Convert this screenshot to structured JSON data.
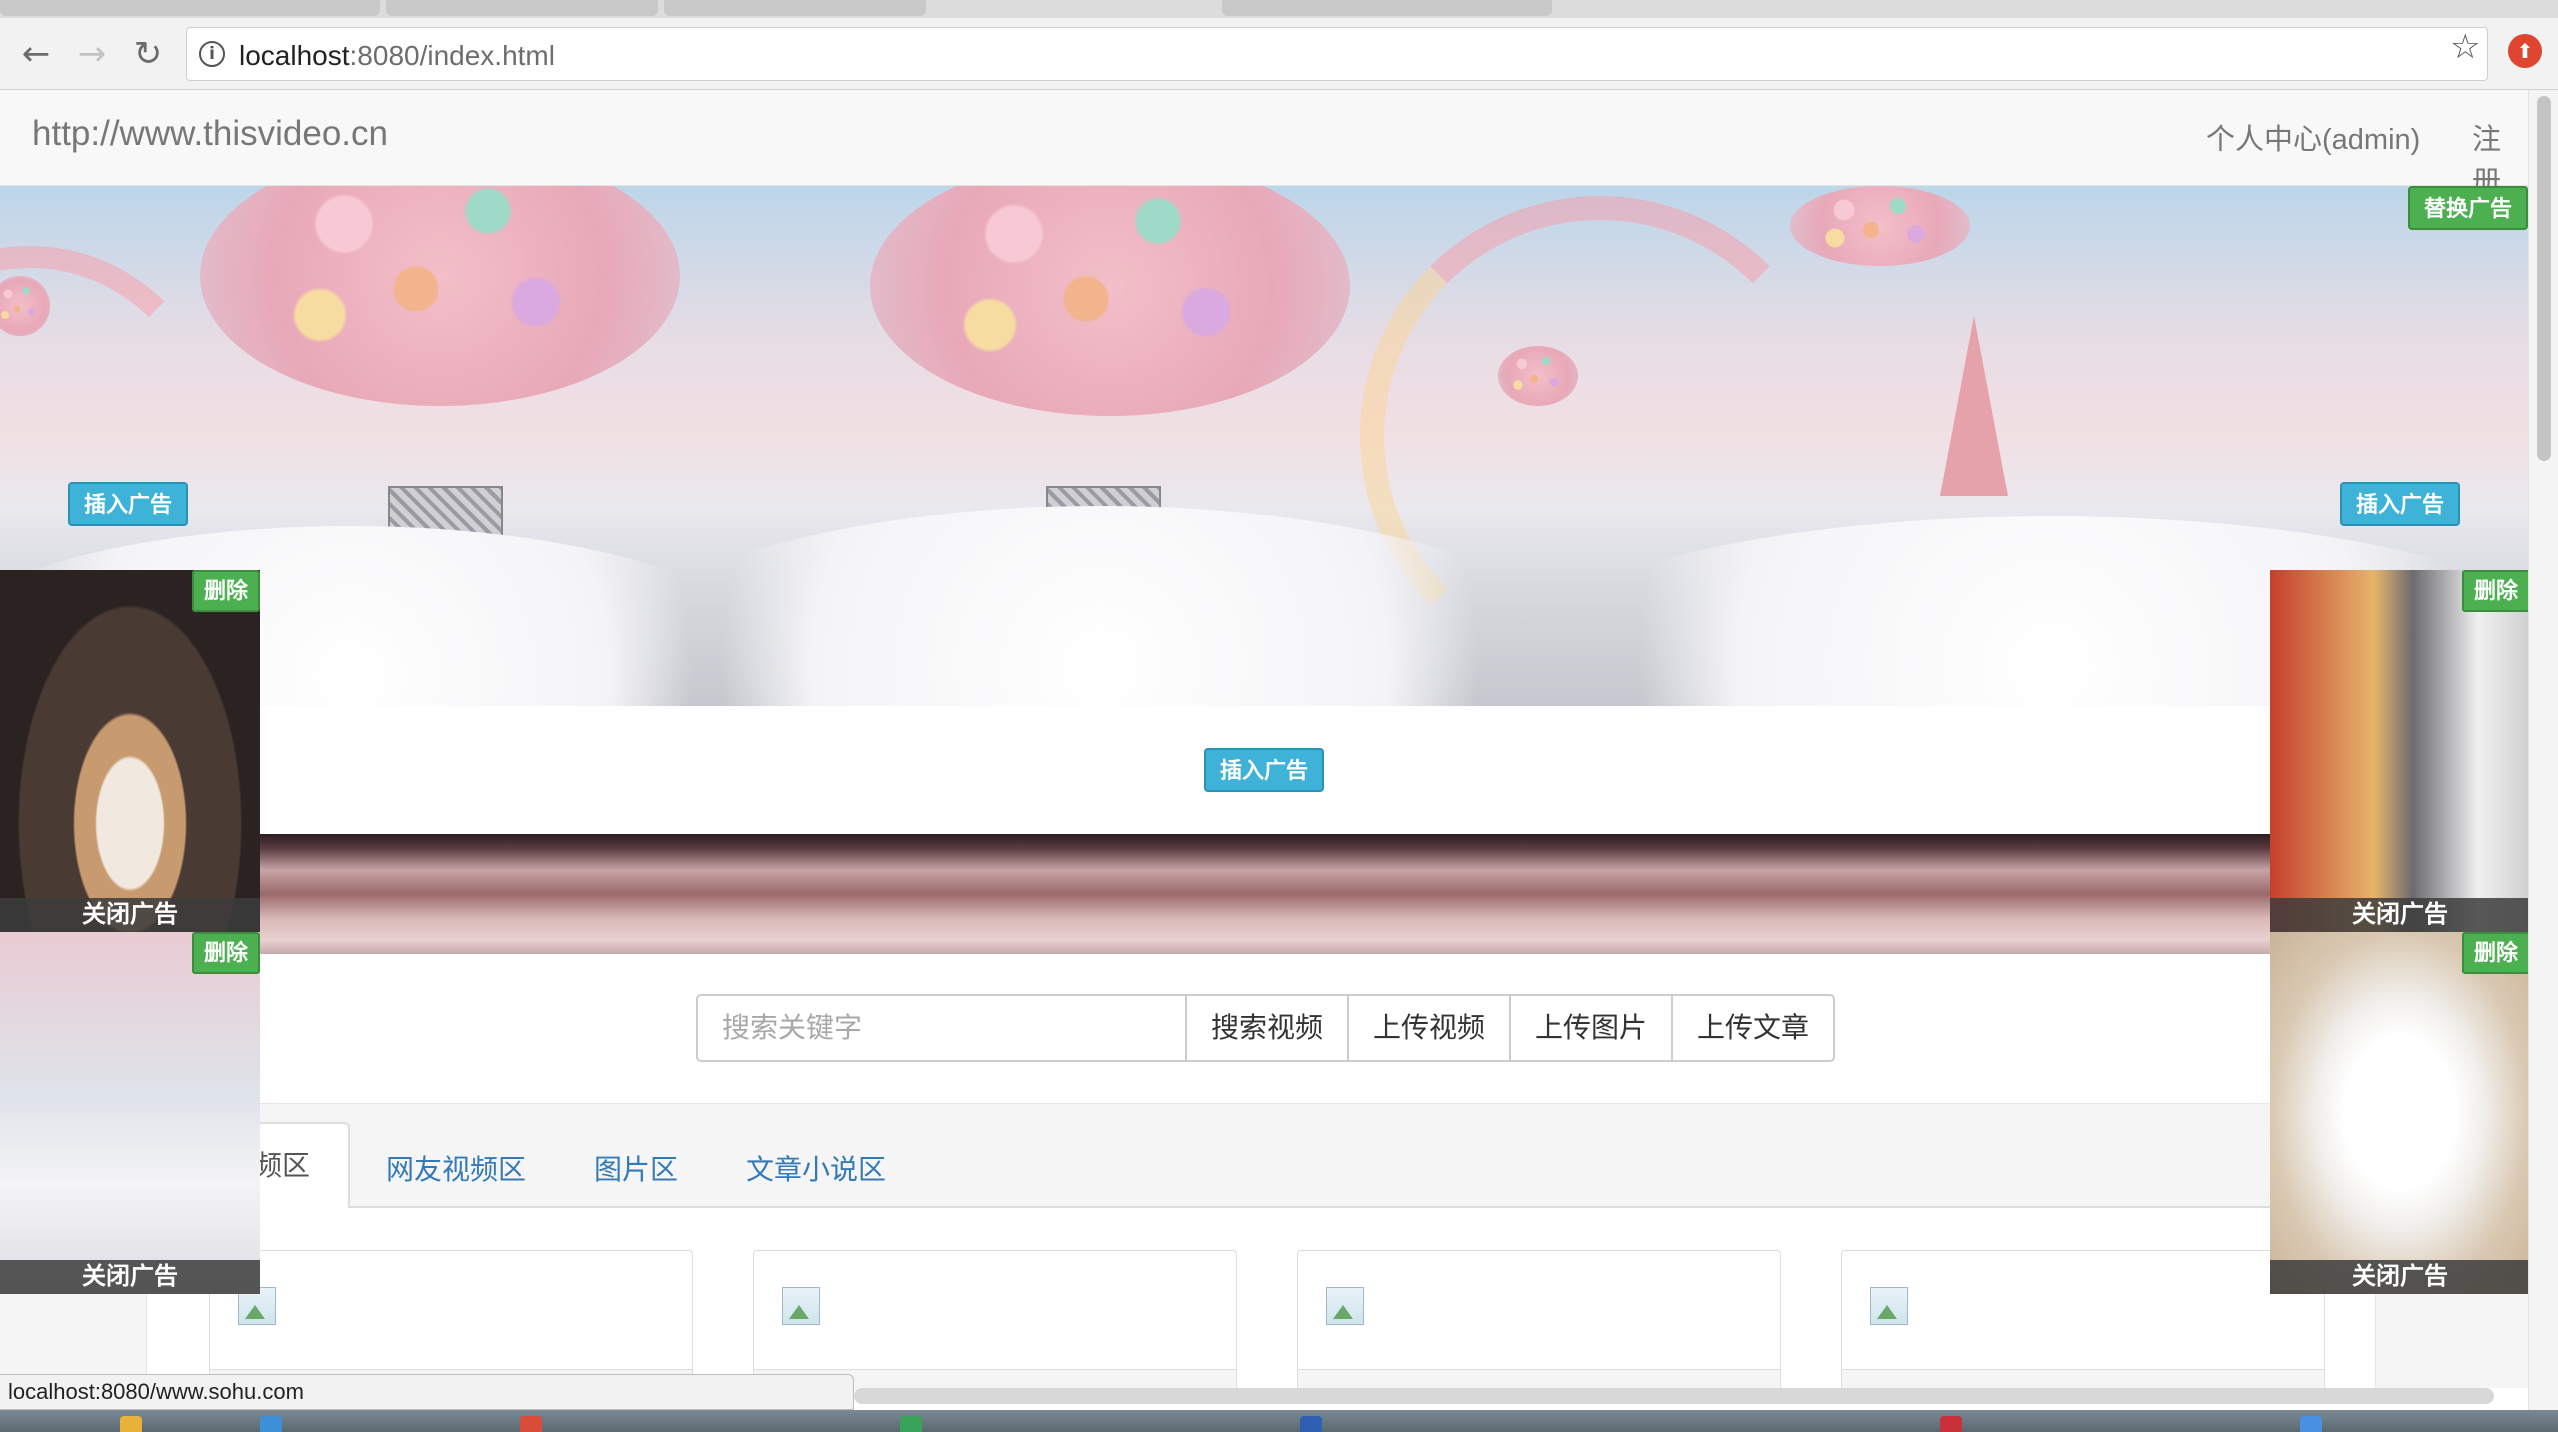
{
  "browser": {
    "url_host": "localhost",
    "url_rest": ":8080/index.html",
    "status_url": "localhost:8080/www.sohu.com"
  },
  "site": {
    "brand": "http://www.thisvideo.cn",
    "nav": {
      "personal_center": "个人中心(admin)",
      "register": "注册"
    }
  },
  "ads": {
    "replace_label": "替换广告",
    "insert_label": "插入广告",
    "delete_label": "删除",
    "close_label": "关闭广告"
  },
  "search": {
    "placeholder": "搜索关键字",
    "buttons": [
      "搜索视频",
      "上传视频",
      "上传图片",
      "上传文章"
    ]
  },
  "tabs": {
    "active_partial": "频区",
    "items": [
      "网友视频区",
      "图片区",
      "文章小说区"
    ]
  },
  "colors": {
    "info": "#3fb2d7",
    "success": "#4caf50",
    "link": "#337ab7"
  }
}
